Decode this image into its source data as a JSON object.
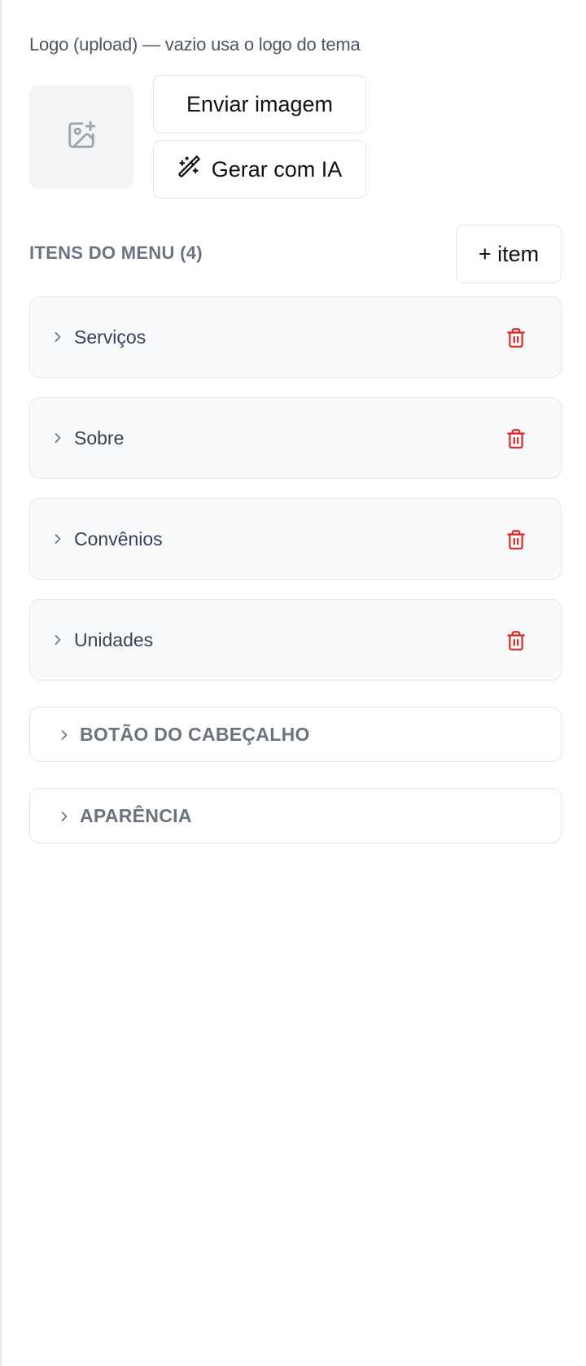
{
  "logo": {
    "label": "Logo (upload) — vazio usa o logo do tema",
    "preview_icon": "image-plus-icon"
  },
  "actions": {
    "upload_label": "Enviar imagem",
    "ai_label": "Gerar com IA",
    "ai_icon": "magic-wand-icon"
  },
  "menu": {
    "title": "ITENS DO MENU (4)",
    "add_label": "+ item",
    "items": [
      {
        "label": "Serviços"
      },
      {
        "label": "Sobre"
      },
      {
        "label": "Convênios"
      },
      {
        "label": "Unidades"
      }
    ]
  },
  "sections": {
    "header_button": "BOTÃO DO CABEÇALHO",
    "appearance": "APARÊNCIA"
  },
  "colors": {
    "danger": "#dc2626",
    "muted": "#6b7280",
    "border": "#e5e7eb"
  }
}
